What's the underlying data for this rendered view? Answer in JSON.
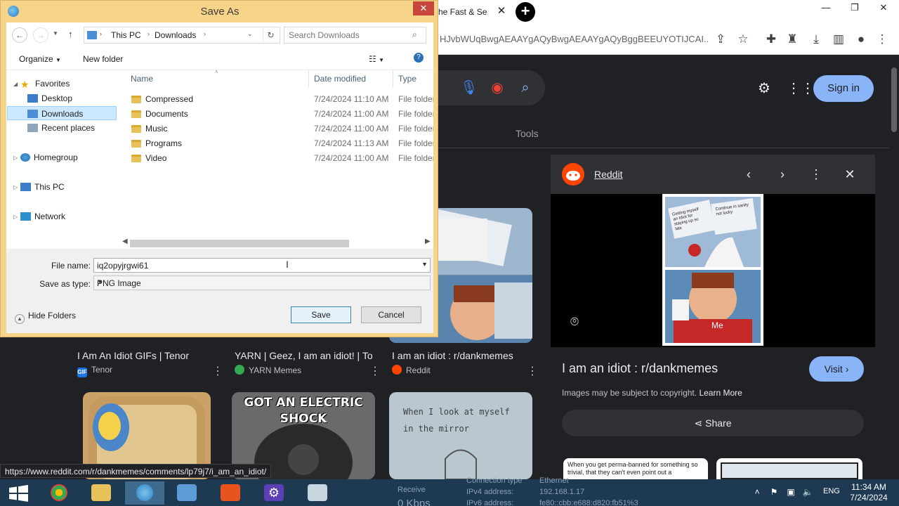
{
  "browser": {
    "tab_title": "he Fast & Se",
    "tab_close": "✕",
    "new_tab": "+",
    "url": "HJvbWUqBwgAEAAYgAQyBwgAEAAYgAQyBggBEEUYOTIJCAI...",
    "window_controls": [
      "—",
      "❐",
      "✕"
    ]
  },
  "google": {
    "signin_label": "Sign in",
    "tools_label": "Tools",
    "results": [
      {
        "title": "I Am An Idiot GIFs | Tenor",
        "source": "Tenor",
        "icon_text": "GIF",
        "icon_color": "#1a73e8"
      },
      {
        "title": "YARN | Geez, I am an idiot! | To...",
        "source": "YARN Memes",
        "icon_text": "",
        "icon_color": "#34a853"
      },
      {
        "title": "I am an idiot : r/dankmemes",
        "source": "Reddit",
        "icon_text": "",
        "icon_color": "#ff4500"
      }
    ],
    "thumb_texts": {
      "bear_caption": "GOT AN ELECTRIC SHOCK",
      "mirror_caption": "When I look at myself in the mirror"
    }
  },
  "side_panel": {
    "site": "Reddit",
    "title": "I am an idiot : r/dankmemes",
    "visit_label": "Visit",
    "copyright_text": "Images may be subject to copyright.",
    "learn_more": "Learn More",
    "share_label": "Share",
    "bottom_card_text": "When you get perma-banned for something so trivial, that they can't even point out a",
    "meme": {
      "button_left": "Getting myself an Idiot for staying up so late",
      "button_right": "Continue in sanity not lucky",
      "label": "Me"
    }
  },
  "status_url": "https://www.reddit.com/r/dankmemes/comments/lp79j7/i_am_an_idiot/",
  "dialog": {
    "title": "Save As",
    "close": "✕",
    "breadcrumb": [
      "This PC",
      "Downloads"
    ],
    "search_placeholder": "Search Downloads",
    "organize_label": "Organize",
    "new_folder_label": "New folder",
    "help": "?",
    "nav_tree": {
      "favorites": "Favorites",
      "desktop": "Desktop",
      "downloads": "Downloads",
      "recent": "Recent places",
      "homegroup": "Homegroup",
      "thispc": "This PC",
      "network": "Network"
    },
    "columns": {
      "name": "Name",
      "date": "Date modified",
      "type": "Type"
    },
    "files": [
      {
        "name": "Compressed",
        "date": "7/24/2024 11:10 AM",
        "type": "File folder"
      },
      {
        "name": "Documents",
        "date": "7/24/2024 11:00 AM",
        "type": "File folder"
      },
      {
        "name": "Music",
        "date": "7/24/2024 11:00 AM",
        "type": "File folder"
      },
      {
        "name": "Programs",
        "date": "7/24/2024 11:13 AM",
        "type": "File folder"
      },
      {
        "name": "Video",
        "date": "7/24/2024 11:00 AM",
        "type": "File folder"
      }
    ],
    "file_name_label": "File name:",
    "file_name_value": "iq2opyjrgwi61",
    "save_type_label": "Save as type:",
    "save_type_value": "PNG Image",
    "hide_folders_label": "Hide Folders",
    "save_label": "Save",
    "cancel_label": "Cancel"
  },
  "taskbar": {
    "net_info": {
      "connection_type_label": "Connection type",
      "connection_type_value": "Ethernet",
      "ipv4_label": "IPv4 address:",
      "ipv4_value": "192.168.1.17",
      "ipv6_label": "IPv6 address:",
      "ipv6_value": "fe80::cbb:e688:d820:fb51%3",
      "receive_label": "Receive",
      "receive_value": "0 Kbps"
    },
    "language": "ENG",
    "time": "11:34 AM",
    "date": "7/24/2024"
  }
}
